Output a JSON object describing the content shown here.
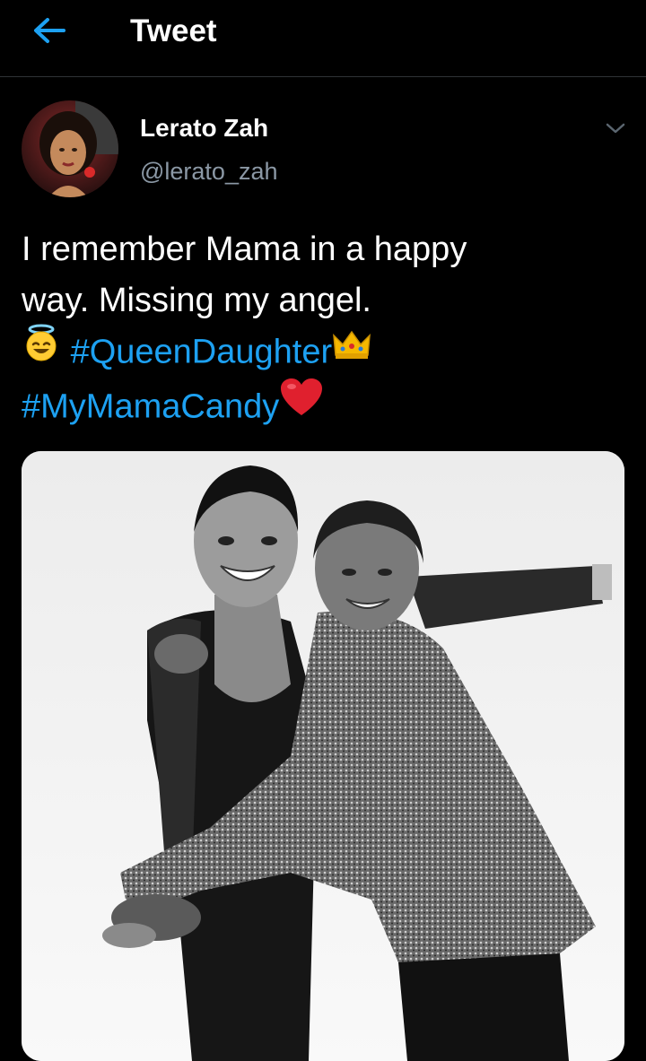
{
  "topbar": {
    "back_icon": "arrow-left-icon",
    "title": "Tweet"
  },
  "author": {
    "name": "Lerato Zah",
    "handle": "@lerato_zah",
    "menu_icon": "chevron-down-icon"
  },
  "tweet": {
    "line1": "I remember Mama in a happy",
    "line2": "way. Missing my angel.",
    "hashtag1": "#QueenDaughter",
    "hashtag2": "#MyMamaCandy",
    "emojis": [
      "smiling-face-with-halo-icon",
      "crown-icon",
      "red-heart-icon"
    ]
  },
  "media": {
    "type": "photo",
    "style": "black-and-white"
  },
  "colors": {
    "background": "#000000",
    "accent": "#1da1f2",
    "secondary_text": "#8b98a5",
    "divider": "#2f3336"
  }
}
